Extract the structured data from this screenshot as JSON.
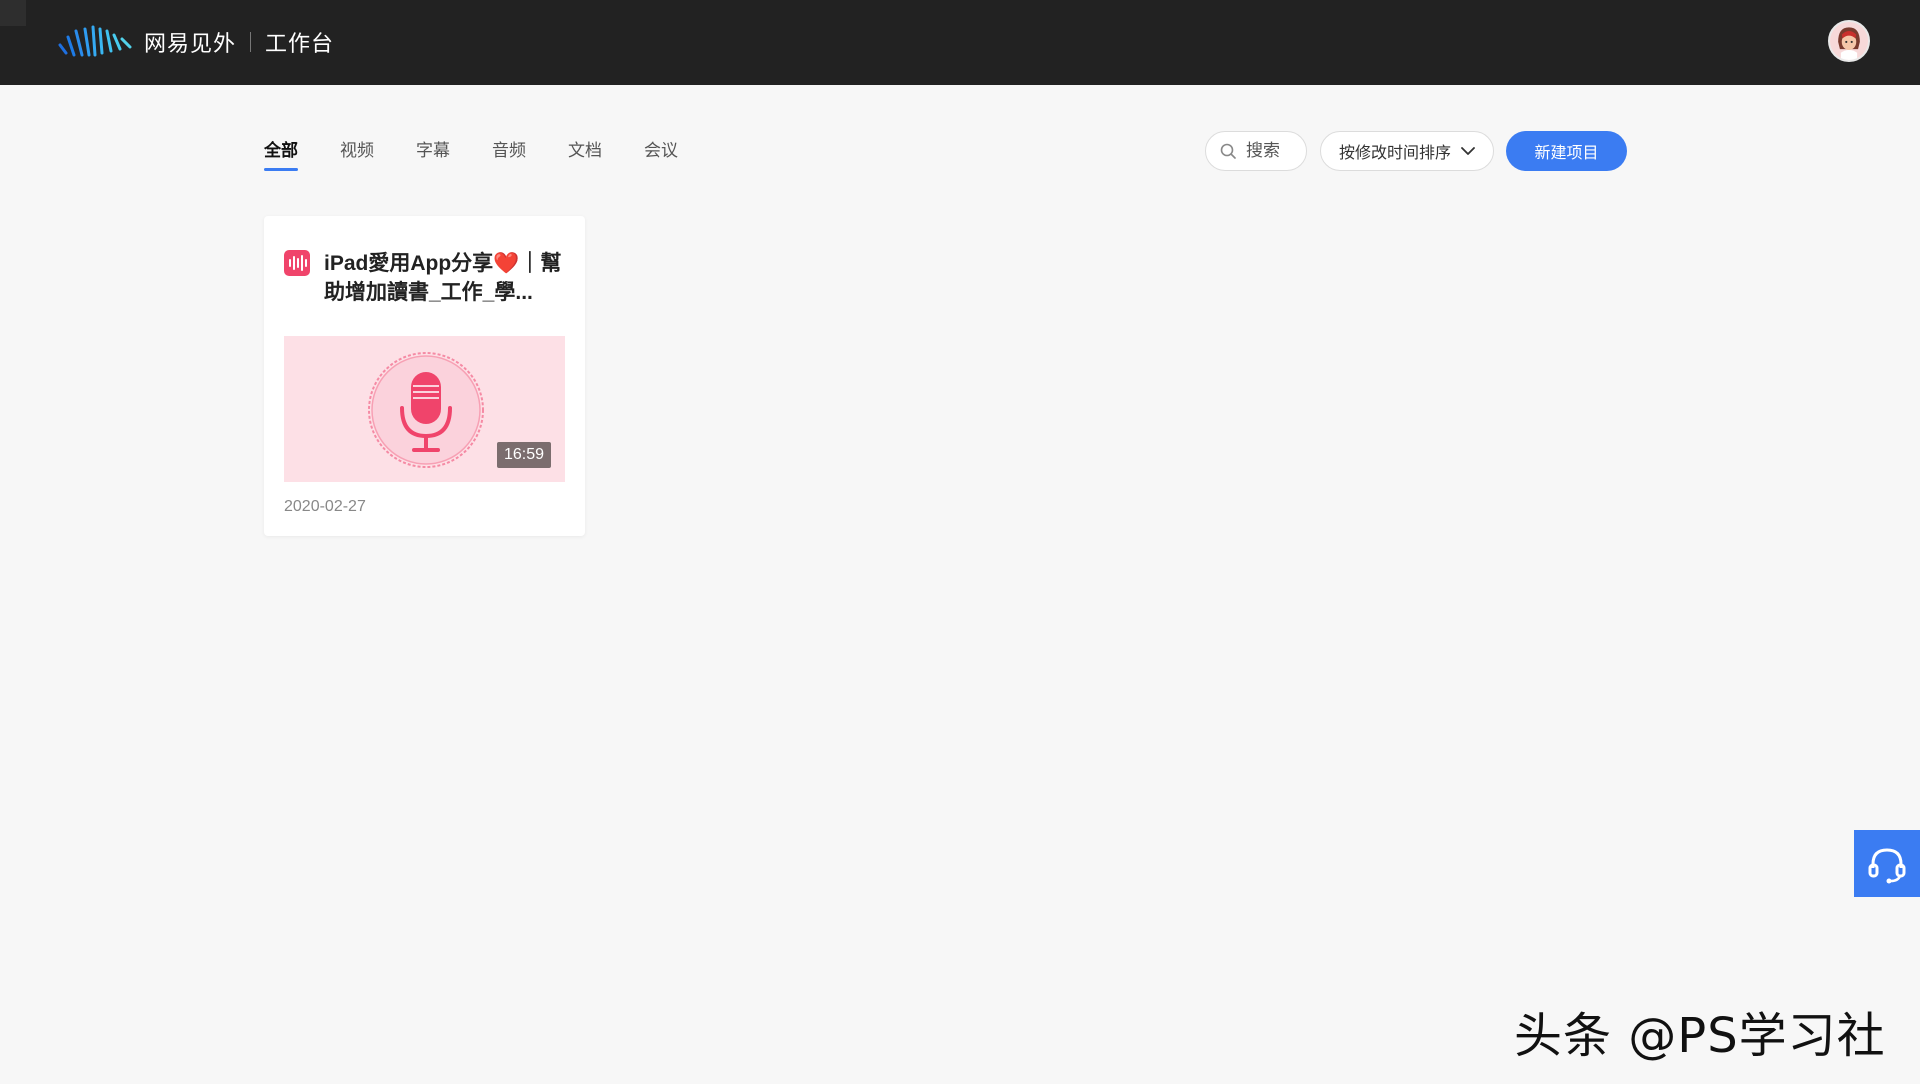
{
  "header": {
    "brand_name": "网易见外",
    "brand_sub": "工作台",
    "logo_icon": "soundwave-logo-icon",
    "avatar_icon": "user-avatar-icon"
  },
  "tabs": [
    {
      "label": "全部",
      "active": true
    },
    {
      "label": "视频",
      "active": false
    },
    {
      "label": "字幕",
      "active": false
    },
    {
      "label": "音频",
      "active": false
    },
    {
      "label": "文档",
      "active": false
    },
    {
      "label": "会议",
      "active": false
    }
  ],
  "toolbar": {
    "search_placeholder": "搜索",
    "sort_label": "按修改时间排序",
    "new_project_label": "新建项目"
  },
  "projects": [
    {
      "type_icon": "audio-file-icon",
      "title": "iPad愛用App分享❤️｜幫助增加讀書_工作_學...",
      "duration": "16:59",
      "date": "2020-02-27"
    }
  ],
  "support": {
    "icon": "headset-icon"
  },
  "watermark": "头条 @PS学习社",
  "colors": {
    "topbar": "#222222",
    "accent": "#3b7cf2",
    "audio_pink": "#f0446b",
    "thumb_bg": "#fde0e6"
  }
}
